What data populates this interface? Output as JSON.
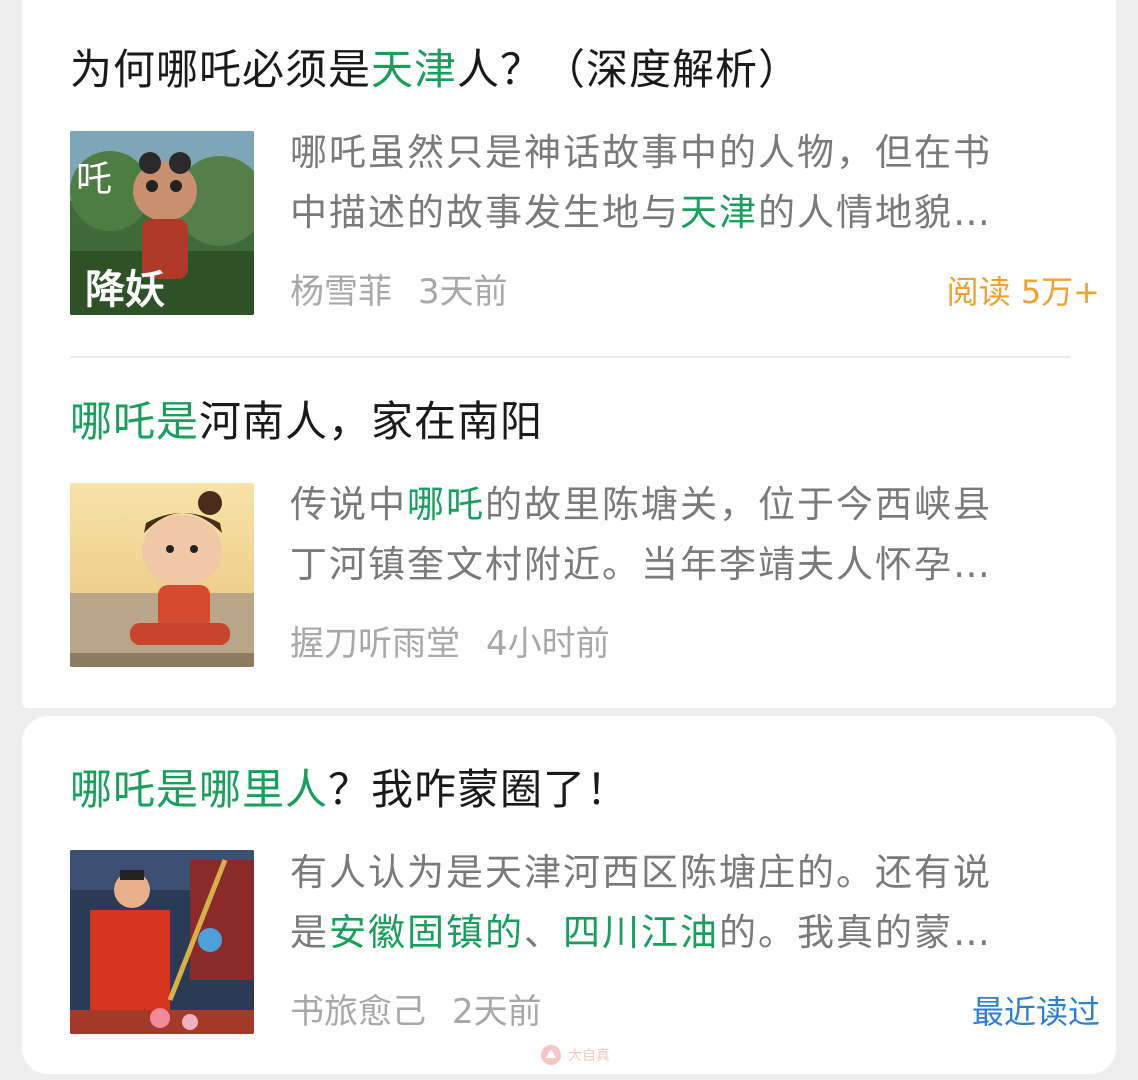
{
  "articles": [
    {
      "title_parts": [
        {
          "text": "为何哪吒必须是",
          "hl": false
        },
        {
          "text": "天津",
          "hl": true
        },
        {
          "text": "人？（深度解析）",
          "hl": false
        }
      ],
      "snippet_lines": [
        [
          {
            "text": "哪吒虽然只是神话故事中的人物，但在书",
            "hl": false
          }
        ],
        [
          {
            "text": "中描述的故事发生地与",
            "hl": false
          },
          {
            "text": "天津",
            "hl": true
          },
          {
            "text": "的人情地貌…",
            "hl": false
          }
        ]
      ],
      "thumb_overlay_text": "吒 降妖",
      "author": "杨雪菲",
      "time": "3天前",
      "badge": "阅读 5万+",
      "badge_color": "#f0a030"
    },
    {
      "title_parts": [
        {
          "text": "哪吒是",
          "hl": true
        },
        {
          "text": "河南人，家在南阳",
          "hl": false
        }
      ],
      "snippet_lines": [
        [
          {
            "text": "传说中",
            "hl": false
          },
          {
            "text": "哪吒",
            "hl": true
          },
          {
            "text": "的故里陈塘关，位于今西峡县",
            "hl": false
          }
        ],
        [
          {
            "text": "丁河镇奎文村附近。当年李靖夫人怀孕…",
            "hl": false
          }
        ]
      ],
      "author": "握刀听雨堂",
      "time": "4小时前",
      "badge": "",
      "badge_color": ""
    },
    {
      "title_parts": [
        {
          "text": "哪吒是哪里人",
          "hl": true
        },
        {
          "text": "？我咋蒙圈了！",
          "hl": false
        }
      ],
      "snippet_lines": [
        [
          {
            "text": "有人认为是天津河西区陈塘庄的。还有说",
            "hl": false
          }
        ],
        [
          {
            "text": "是",
            "hl": false
          },
          {
            "text": "安徽固镇的",
            "hl": true
          },
          {
            "text": "、",
            "hl": false
          },
          {
            "text": "四川江油",
            "hl": true
          },
          {
            "text": "的。我真的蒙…",
            "hl": false
          }
        ]
      ],
      "author": "书旅愈己",
      "time": "2天前",
      "badge": "最近读过",
      "badge_color": "#2f7fd0"
    }
  ],
  "highlight_color": "#16a05c",
  "watermark": "大自真"
}
